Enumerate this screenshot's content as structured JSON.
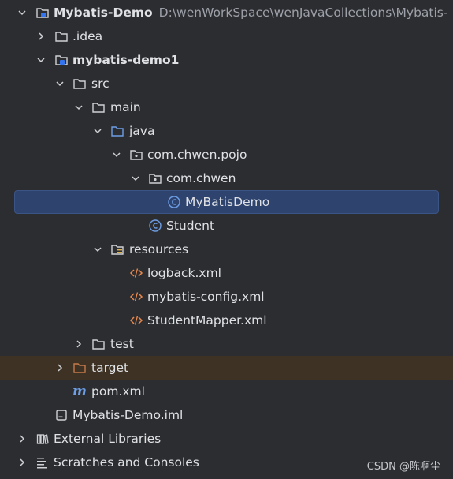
{
  "project": {
    "name": "Mybatis-Demo",
    "path": "D:\\wenWorkSpace\\wenJavaCollections\\Mybatis-"
  },
  "tree": {
    "idea": ".idea",
    "module": "mybatis-demo1",
    "src": "src",
    "main": "main",
    "java": "java",
    "pkg_pojo": "com.chwen.pojo",
    "pkg_chwen": "com.chwen",
    "class_mybatisdemo": "MyBatisDemo",
    "class_student": "Student",
    "resources": "resources",
    "file_logback": "logback.xml",
    "file_mybatis_config": "mybatis-config.xml",
    "file_student_mapper": "StudentMapper.xml",
    "test": "test",
    "target": "target",
    "pom": "pom.xml",
    "iml": "Mybatis-Demo.iml",
    "external_libraries": "External Libraries",
    "scratches": "Scratches and Consoles"
  },
  "watermark": "CSDN @陈啊尘",
  "colors": {
    "background": "#2b2d30",
    "selected_row": "#2e436e",
    "excluded_row": "#3d3223",
    "folder_blue": "#6d9ee6",
    "class_blue": "#6d9ee6",
    "xml_orange": "#e8884d",
    "target_orange": "#c57a4a"
  }
}
